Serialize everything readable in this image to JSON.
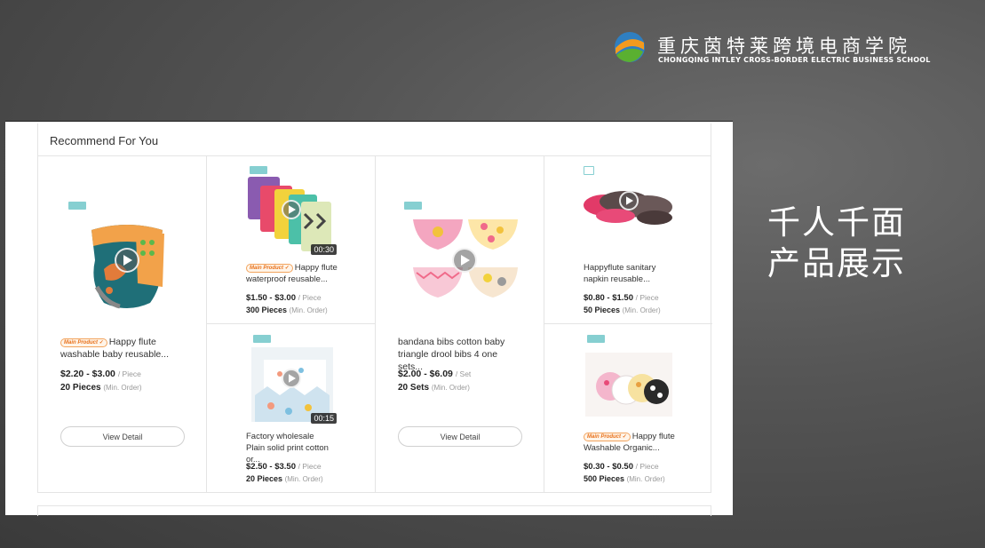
{
  "brand": {
    "name_cn": "重庆茵特莱跨境电商学院",
    "name_en": "CHONGQING INTLEY CROSS-BORDER ELECTRIC BUSINESS SCHOOL"
  },
  "slogan": {
    "line1": "千人千面",
    "line2": "产品展示"
  },
  "section": {
    "title": "Recommend For You"
  },
  "labels": {
    "main_product": "Main Product",
    "view_detail": "View Detail",
    "min_order": "(Min. Order)"
  },
  "products": [
    {
      "title": "Happy flute washable baby reusable...",
      "main_product": true,
      "price": "$2.20 - $3.00",
      "unit": "/ Piece",
      "moq": "20 Pieces",
      "has_video": true,
      "duration": ""
    },
    {
      "title": "Happy flute waterproof reusable...",
      "main_product": true,
      "price": "$1.50 - $3.00",
      "unit": "/ Piece",
      "moq": "300 Pieces",
      "has_video": true,
      "duration": "00:30"
    },
    {
      "title": "bandana bibs cotton baby triangle drool bibs 4 one sets...",
      "main_product": false,
      "price": "$2.00 - $6.09",
      "unit": "/ Set",
      "moq": "20 Sets",
      "has_video": true,
      "duration": ""
    },
    {
      "title": "Happyflute sanitary napkin reusable...",
      "main_product": false,
      "price": "$0.80 - $1.50",
      "unit": "/ Piece",
      "moq": "50 Pieces",
      "has_video": true,
      "duration": ""
    },
    {
      "title": "Factory wholesale Plain solid print cotton or...",
      "main_product": false,
      "price": "$2.50 - $3.50",
      "unit": "/ Piece",
      "moq": "20 Pieces",
      "has_video": true,
      "duration": "00:15"
    },
    {
      "title": "Happy flute Washable Organic...",
      "main_product": true,
      "price": "$0.30 - $0.50",
      "unit": "/ Piece",
      "moq": "500 Pieces",
      "has_video": false,
      "duration": ""
    }
  ],
  "colors": {
    "accent_orange": "#e8711b",
    "tag_teal": "#86cfd1",
    "background_gray": "#555555"
  }
}
